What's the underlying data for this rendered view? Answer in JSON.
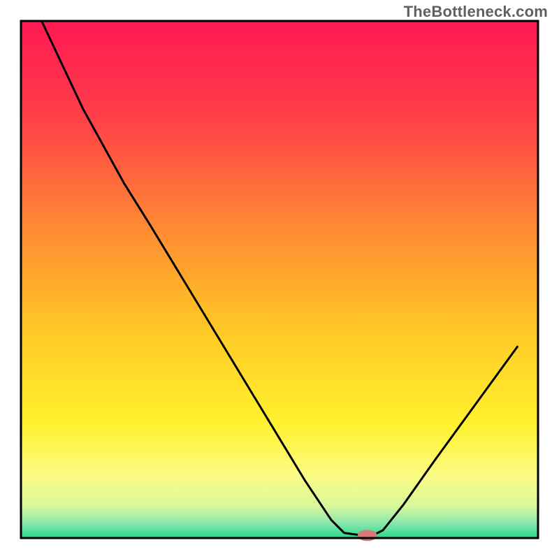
{
  "watermark": "TheBottleneck.com",
  "chart_data": {
    "type": "line",
    "title": "",
    "xlabel": "",
    "ylabel": "",
    "x_range": [
      0,
      100
    ],
    "y_range": [
      0,
      100
    ],
    "curve_points": [
      {
        "x": 4.0,
        "y": 100.0
      },
      {
        "x": 12.0,
        "y": 83.0
      },
      {
        "x": 20.0,
        "y": 68.5
      },
      {
        "x": 25.0,
        "y": 60.5
      },
      {
        "x": 35.0,
        "y": 44.0
      },
      {
        "x": 45.0,
        "y": 27.5
      },
      {
        "x": 55.0,
        "y": 11.0
      },
      {
        "x": 60.0,
        "y": 3.5
      },
      {
        "x": 62.5,
        "y": 1.0
      },
      {
        "x": 66.0,
        "y": 0.5
      },
      {
        "x": 68.0,
        "y": 0.5
      },
      {
        "x": 70.0,
        "y": 1.5
      },
      {
        "x": 74.0,
        "y": 6.5
      },
      {
        "x": 80.0,
        "y": 15.0
      },
      {
        "x": 88.0,
        "y": 26.0
      },
      {
        "x": 96.0,
        "y": 37.0
      }
    ],
    "marker": {
      "x": 67.0,
      "y": 0.5,
      "color": "#d97a7a"
    },
    "background_gradient": {
      "stops": [
        {
          "pct": 0,
          "color": "#ff1a53"
        },
        {
          "pct": 18,
          "color": "#ff3d49"
        },
        {
          "pct": 40,
          "color": "#ff8a33"
        },
        {
          "pct": 60,
          "color": "#ffc926"
        },
        {
          "pct": 78,
          "color": "#fff22e"
        },
        {
          "pct": 88,
          "color": "#fcfc85"
        },
        {
          "pct": 94,
          "color": "#d6f79a"
        },
        {
          "pct": 97,
          "color": "#8de8ad"
        },
        {
          "pct": 100,
          "color": "#28d98c"
        }
      ]
    },
    "plot_frame_color": "#000000",
    "curve_color": "#000000"
  }
}
